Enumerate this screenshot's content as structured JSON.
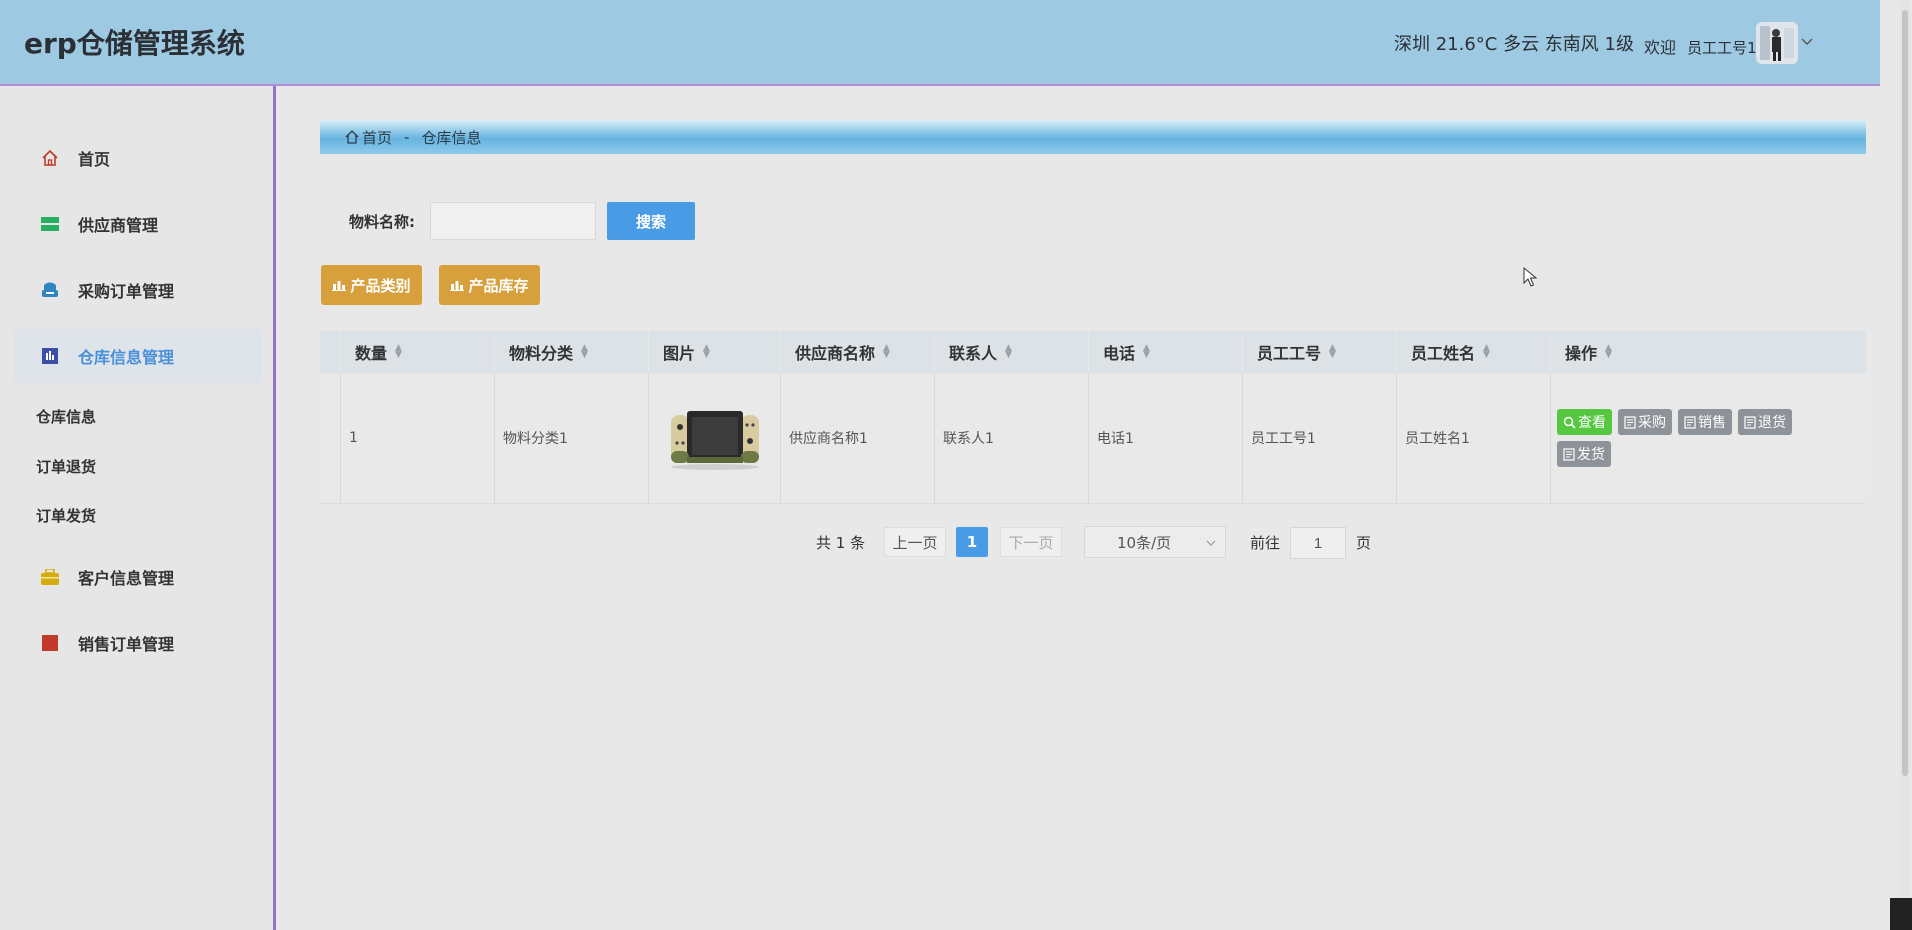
{
  "header": {
    "title": "erp仓储管理系统",
    "weather": "深圳 21.6°C 多云 东南风 1级",
    "welcome": "欢迎",
    "username": "员工工号1"
  },
  "sidebar": {
    "items": [
      {
        "label": "首页",
        "icon": "home-icon",
        "color": "#c0392b"
      },
      {
        "label": "供应商管理",
        "icon": "supplier-icon",
        "color": "#27ae60"
      },
      {
        "label": "采购订单管理",
        "icon": "purchase-icon",
        "color": "#2e86c1"
      },
      {
        "label": "仓库信息管理",
        "icon": "warehouse-icon",
        "color": "#3a4fa8"
      },
      {
        "label": "客户信息管理",
        "icon": "customer-icon",
        "color": "#d4ac0d"
      },
      {
        "label": "销售订单管理",
        "icon": "sales-icon",
        "color": "#c0392b"
      }
    ],
    "sub_items": [
      "仓库信息",
      "订单退货",
      "订单发货"
    ]
  },
  "breadcrumb": {
    "home": "首页",
    "separator": "-",
    "current": "仓库信息"
  },
  "search": {
    "label": "物料名称:",
    "value": "",
    "placeholder": "",
    "button": "搜索"
  },
  "actions": {
    "category": "产品类别",
    "stock": "产品库存"
  },
  "table": {
    "columns": [
      "数量",
      "物料分类",
      "图片",
      "供应商名称",
      "联系人",
      "电话",
      "员工工号",
      "员工姓名",
      "操作"
    ],
    "rows": [
      {
        "quantity": "1",
        "category": "物料分类1",
        "supplier": "供应商名称1",
        "contact": "联系人1",
        "phone": "电话1",
        "employee_id": "员工工号1",
        "employee_name": "员工姓名1",
        "ops": [
          "查看",
          "采购",
          "销售",
          "退货",
          "发货"
        ]
      }
    ]
  },
  "pagination": {
    "total": "共 1 条",
    "prev": "上一页",
    "current": "1",
    "next": "下一页",
    "page_size": "10条/页",
    "goto_label": "前往",
    "goto_value": "1",
    "page_suffix": "页"
  },
  "colors": {
    "header_bg": "#9ec9e2",
    "accent": "#4a9be5",
    "gold": "#d89f3d",
    "view_green": "#55c740"
  }
}
